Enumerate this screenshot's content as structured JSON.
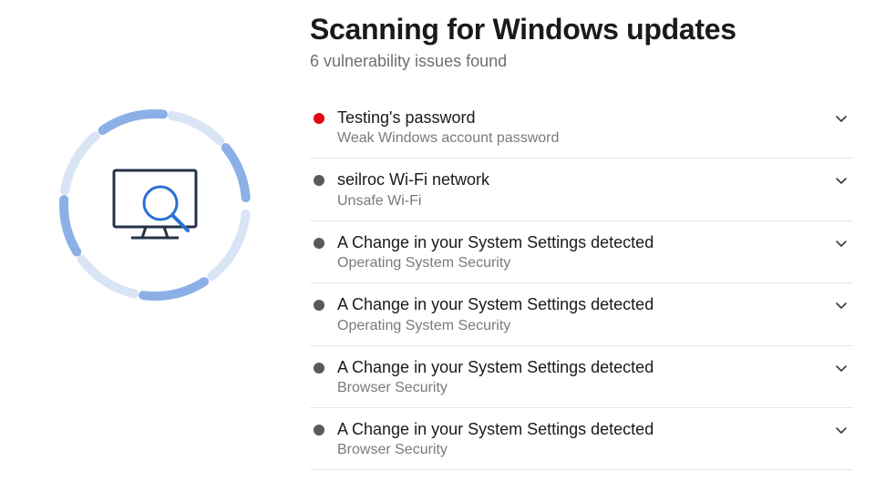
{
  "header": {
    "title": "Scanning for Windows updates",
    "subtitle": "6 vulnerability issues found"
  },
  "graphic": {
    "name": "monitor-scan-icon"
  },
  "issues": [
    {
      "severity": "red",
      "title": "Testing's password",
      "description": "Weak Windows account password"
    },
    {
      "severity": "gray",
      "title": "seilroc Wi-Fi network",
      "description": "Unsafe Wi-Fi"
    },
    {
      "severity": "gray",
      "title": "A Change in your System Settings detected",
      "description": "Operating System Security"
    },
    {
      "severity": "gray",
      "title": "A Change in your System Settings detected",
      "description": "Operating System Security"
    },
    {
      "severity": "gray",
      "title": "A Change in your System Settings detected",
      "description": "Browser Security"
    },
    {
      "severity": "gray",
      "title": "A Change in your System Settings detected",
      "description": "Browser Security"
    }
  ],
  "colors": {
    "severity_red": "#e30613",
    "severity_gray": "#5a5a5a",
    "ring_dark": "#8bb0e6",
    "ring_light": "#d9e4f5",
    "accent_blue": "#2a6fd6",
    "screen_stroke": "#26324a"
  }
}
